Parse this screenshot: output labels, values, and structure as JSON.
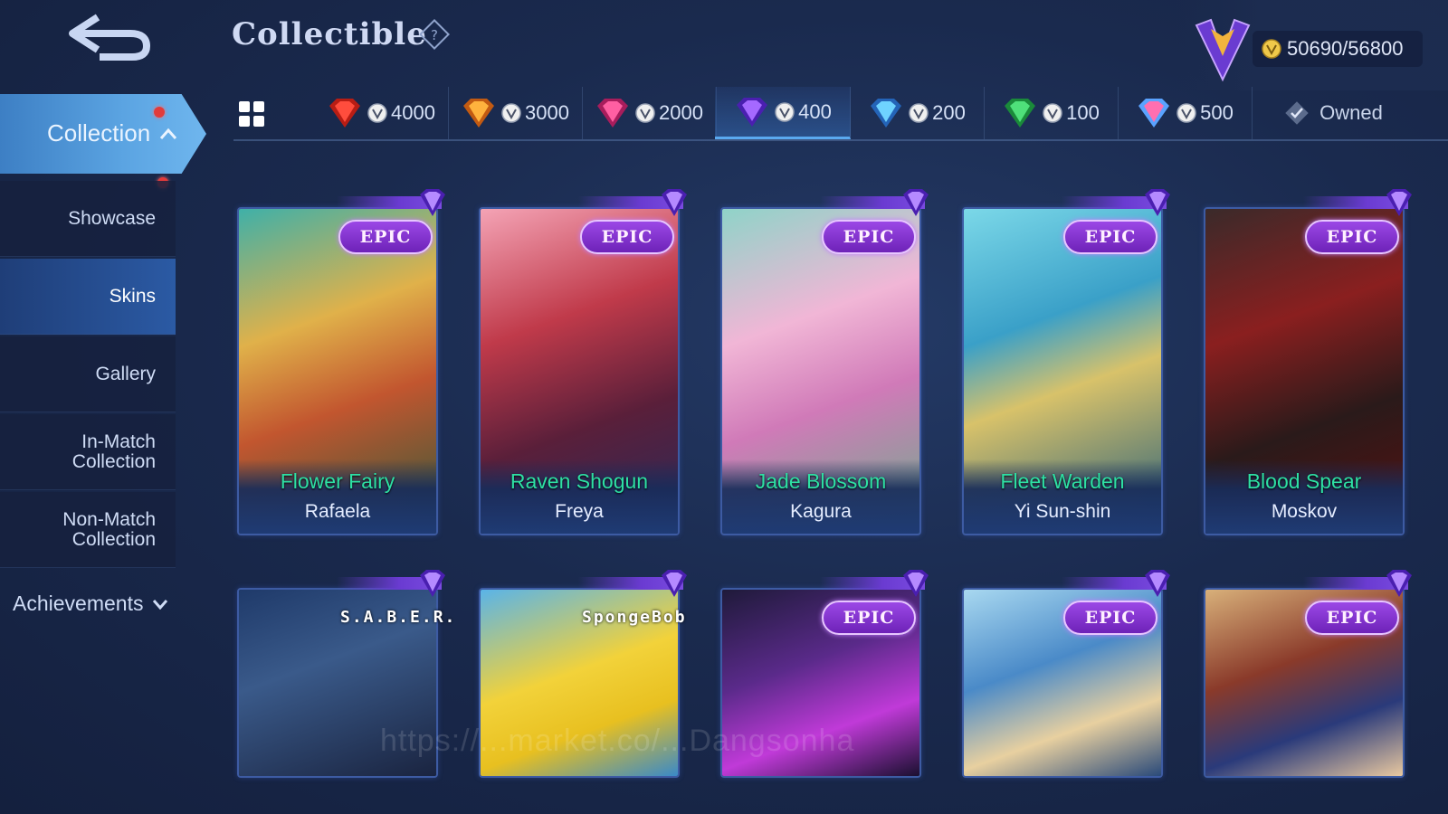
{
  "header": {
    "title": "Collectible",
    "total_points": "50690/56800"
  },
  "sidebar": {
    "collection_label": "Collection",
    "items": [
      {
        "label": "Showcase"
      },
      {
        "label": "Skins",
        "active": true
      },
      {
        "label": "Gallery"
      },
      {
        "label": "In-Match Collection"
      },
      {
        "label": "Non-Match Collection"
      }
    ],
    "achievements_label": "Achievements"
  },
  "tabs": [
    {
      "points": "4000",
      "gem": "legend-red-gem-icon"
    },
    {
      "points": "3000",
      "gem": "collector-orange-gem-icon"
    },
    {
      "points": "2000",
      "gem": "special-pink-gem-icon"
    },
    {
      "points": "400",
      "gem": "epic-purple-gem-icon",
      "selected": true
    },
    {
      "points": "200",
      "gem": "elite-blue-gem-icon"
    },
    {
      "points": "100",
      "gem": "basic-green-gem-icon"
    },
    {
      "points": "500",
      "gem": "mixed-gem-icon"
    }
  ],
  "owned_label": "Owned",
  "cards_row1": [
    {
      "badge": "EPIC",
      "skin": "Flower Fairy",
      "hero": "Rafaela"
    },
    {
      "badge": "EPIC",
      "skin": "Raven Shogun",
      "hero": "Freya"
    },
    {
      "badge": "EPIC",
      "skin": "Jade Blossom",
      "hero": "Kagura"
    },
    {
      "badge": "EPIC",
      "skin": "Fleet Warden",
      "hero": "Yi Sun-shin"
    },
    {
      "badge": "EPIC",
      "skin": "Blood Spear",
      "hero": "Moskov"
    }
  ],
  "cards_row2": [
    {
      "label": "S.A.B.E.R."
    },
    {
      "label": "SpongeBob"
    },
    {
      "badge": "EPIC"
    },
    {
      "badge": "EPIC"
    },
    {
      "badge": "EPIC"
    }
  ],
  "watermark": "https://...market.co/...Dangsonha",
  "colors": {
    "accent": "#5aa9f0",
    "epic_purple": "#7a3bd1",
    "skin_name_green": "#2ee0a4",
    "background": "#1a2a4e"
  }
}
